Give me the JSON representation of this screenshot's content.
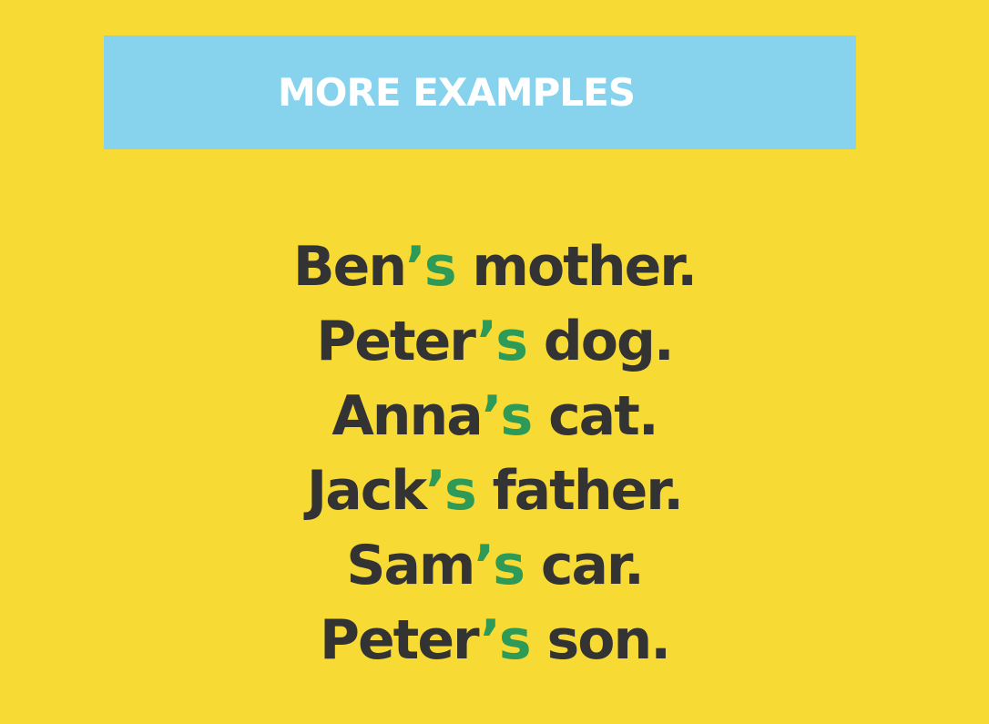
{
  "banner": {
    "title": "MORE EXAMPLES"
  },
  "examples": [
    {
      "name": "Ben",
      "suffix": "’s",
      "rest": " mother."
    },
    {
      "name": "Peter",
      "suffix": "’s",
      "rest": " dog."
    },
    {
      "name": "Anna",
      "suffix": "’s",
      "rest": " cat."
    },
    {
      "name": "Jack",
      "suffix": "’s",
      "rest": " father."
    },
    {
      "name": "Sam",
      "suffix": "’s",
      "rest": " car."
    },
    {
      "name": "Peter",
      "suffix": "’s",
      "rest": " son."
    }
  ],
  "colors": {
    "background": "#F8DA34",
    "banner": "#87D3EE",
    "banner_text": "#FFFFFF",
    "text": "#333333",
    "possessive_suffix": "#2E9A57"
  }
}
